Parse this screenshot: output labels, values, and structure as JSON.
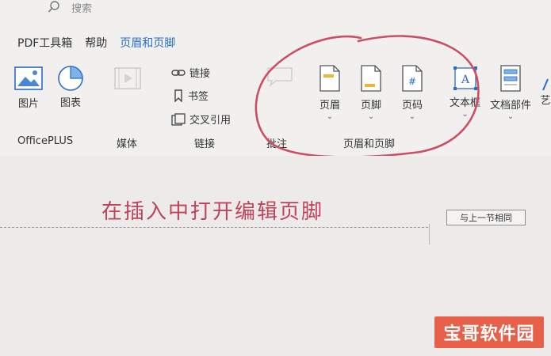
{
  "search": {
    "placeholder": "搜索"
  },
  "tabs": [
    {
      "label": "PDF工具箱"
    },
    {
      "label": "帮助"
    },
    {
      "label": "页眉和页脚"
    }
  ],
  "ribbon": {
    "picture": "图片",
    "chart": "图表",
    "link": "链接",
    "bookmark": "书签",
    "cross_ref": "交叉引用",
    "header": "页眉",
    "footer": "页脚",
    "page_number": "页码",
    "textbox": "文本框",
    "doc_parts": "文档部件",
    "art_partial": "艺"
  },
  "groups": {
    "officeplus": "OfficePLUS",
    "media": "媒体",
    "links": "链接",
    "comments": "批注",
    "header_footer": "页眉和页脚"
  },
  "document": {
    "annotation": "在插入中打开编辑页脚",
    "same_as_previous": "与上一节相同"
  },
  "watermark": "宝哥软件园",
  "colors": {
    "accent": "#2b6cc4",
    "annotation": "#c0435a",
    "circle": "#cc4e63",
    "watermark_bg": "#e6604a"
  }
}
